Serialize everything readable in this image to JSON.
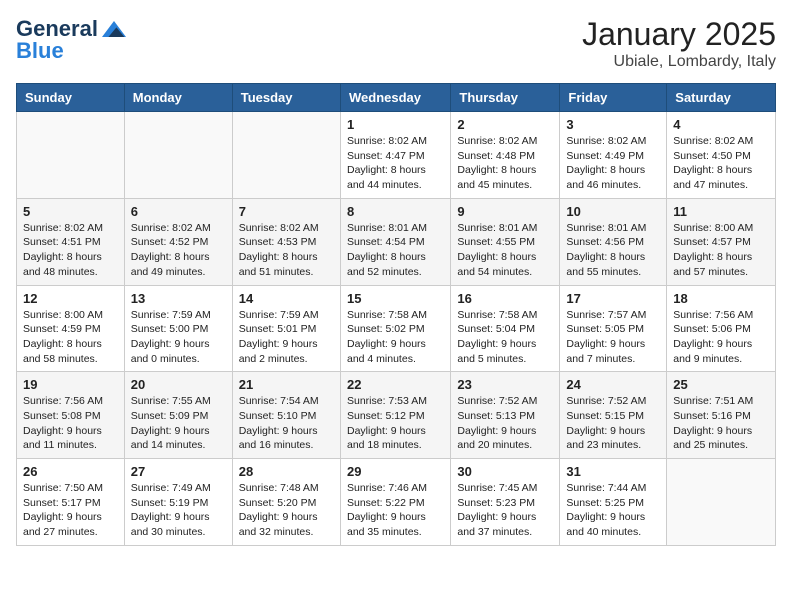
{
  "header": {
    "logo_general": "General",
    "logo_blue": "Blue",
    "month_title": "January 2025",
    "location": "Ubiale, Lombardy, Italy"
  },
  "days_of_week": [
    "Sunday",
    "Monday",
    "Tuesday",
    "Wednesday",
    "Thursday",
    "Friday",
    "Saturday"
  ],
  "weeks": [
    [
      {
        "day": "",
        "content": ""
      },
      {
        "day": "",
        "content": ""
      },
      {
        "day": "",
        "content": ""
      },
      {
        "day": "1",
        "content": "Sunrise: 8:02 AM\nSunset: 4:47 PM\nDaylight: 8 hours\nand 44 minutes."
      },
      {
        "day": "2",
        "content": "Sunrise: 8:02 AM\nSunset: 4:48 PM\nDaylight: 8 hours\nand 45 minutes."
      },
      {
        "day": "3",
        "content": "Sunrise: 8:02 AM\nSunset: 4:49 PM\nDaylight: 8 hours\nand 46 minutes."
      },
      {
        "day": "4",
        "content": "Sunrise: 8:02 AM\nSunset: 4:50 PM\nDaylight: 8 hours\nand 47 minutes."
      }
    ],
    [
      {
        "day": "5",
        "content": "Sunrise: 8:02 AM\nSunset: 4:51 PM\nDaylight: 8 hours\nand 48 minutes."
      },
      {
        "day": "6",
        "content": "Sunrise: 8:02 AM\nSunset: 4:52 PM\nDaylight: 8 hours\nand 49 minutes."
      },
      {
        "day": "7",
        "content": "Sunrise: 8:02 AM\nSunset: 4:53 PM\nDaylight: 8 hours\nand 51 minutes."
      },
      {
        "day": "8",
        "content": "Sunrise: 8:01 AM\nSunset: 4:54 PM\nDaylight: 8 hours\nand 52 minutes."
      },
      {
        "day": "9",
        "content": "Sunrise: 8:01 AM\nSunset: 4:55 PM\nDaylight: 8 hours\nand 54 minutes."
      },
      {
        "day": "10",
        "content": "Sunrise: 8:01 AM\nSunset: 4:56 PM\nDaylight: 8 hours\nand 55 minutes."
      },
      {
        "day": "11",
        "content": "Sunrise: 8:00 AM\nSunset: 4:57 PM\nDaylight: 8 hours\nand 57 minutes."
      }
    ],
    [
      {
        "day": "12",
        "content": "Sunrise: 8:00 AM\nSunset: 4:59 PM\nDaylight: 8 hours\nand 58 minutes."
      },
      {
        "day": "13",
        "content": "Sunrise: 7:59 AM\nSunset: 5:00 PM\nDaylight: 9 hours\nand 0 minutes."
      },
      {
        "day": "14",
        "content": "Sunrise: 7:59 AM\nSunset: 5:01 PM\nDaylight: 9 hours\nand 2 minutes."
      },
      {
        "day": "15",
        "content": "Sunrise: 7:58 AM\nSunset: 5:02 PM\nDaylight: 9 hours\nand 4 minutes."
      },
      {
        "day": "16",
        "content": "Sunrise: 7:58 AM\nSunset: 5:04 PM\nDaylight: 9 hours\nand 5 minutes."
      },
      {
        "day": "17",
        "content": "Sunrise: 7:57 AM\nSunset: 5:05 PM\nDaylight: 9 hours\nand 7 minutes."
      },
      {
        "day": "18",
        "content": "Sunrise: 7:56 AM\nSunset: 5:06 PM\nDaylight: 9 hours\nand 9 minutes."
      }
    ],
    [
      {
        "day": "19",
        "content": "Sunrise: 7:56 AM\nSunset: 5:08 PM\nDaylight: 9 hours\nand 11 minutes."
      },
      {
        "day": "20",
        "content": "Sunrise: 7:55 AM\nSunset: 5:09 PM\nDaylight: 9 hours\nand 14 minutes."
      },
      {
        "day": "21",
        "content": "Sunrise: 7:54 AM\nSunset: 5:10 PM\nDaylight: 9 hours\nand 16 minutes."
      },
      {
        "day": "22",
        "content": "Sunrise: 7:53 AM\nSunset: 5:12 PM\nDaylight: 9 hours\nand 18 minutes."
      },
      {
        "day": "23",
        "content": "Sunrise: 7:52 AM\nSunset: 5:13 PM\nDaylight: 9 hours\nand 20 minutes."
      },
      {
        "day": "24",
        "content": "Sunrise: 7:52 AM\nSunset: 5:15 PM\nDaylight: 9 hours\nand 23 minutes."
      },
      {
        "day": "25",
        "content": "Sunrise: 7:51 AM\nSunset: 5:16 PM\nDaylight: 9 hours\nand 25 minutes."
      }
    ],
    [
      {
        "day": "26",
        "content": "Sunrise: 7:50 AM\nSunset: 5:17 PM\nDaylight: 9 hours\nand 27 minutes."
      },
      {
        "day": "27",
        "content": "Sunrise: 7:49 AM\nSunset: 5:19 PM\nDaylight: 9 hours\nand 30 minutes."
      },
      {
        "day": "28",
        "content": "Sunrise: 7:48 AM\nSunset: 5:20 PM\nDaylight: 9 hours\nand 32 minutes."
      },
      {
        "day": "29",
        "content": "Sunrise: 7:46 AM\nSunset: 5:22 PM\nDaylight: 9 hours\nand 35 minutes."
      },
      {
        "day": "30",
        "content": "Sunrise: 7:45 AM\nSunset: 5:23 PM\nDaylight: 9 hours\nand 37 minutes."
      },
      {
        "day": "31",
        "content": "Sunrise: 7:44 AM\nSunset: 5:25 PM\nDaylight: 9 hours\nand 40 minutes."
      },
      {
        "day": "",
        "content": ""
      }
    ]
  ]
}
